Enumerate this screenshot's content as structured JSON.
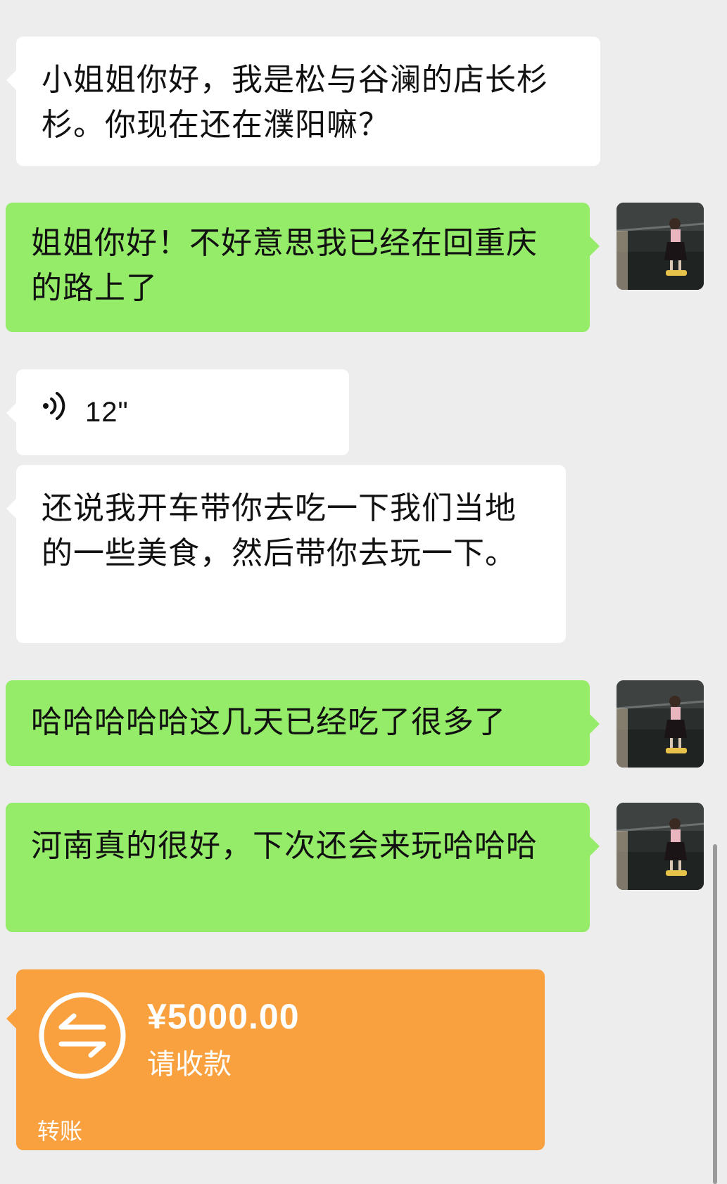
{
  "messages": [
    {
      "side": "in",
      "type": "text",
      "text": "小姐姐你好，我是松与谷澜的店长杉杉。你现在还在濮阳嘛？"
    },
    {
      "side": "out",
      "type": "text",
      "text": "姐姐你好！不好意思我已经在回重庆的路上了"
    },
    {
      "side": "in",
      "type": "voice",
      "duration": "12\""
    },
    {
      "side": "in",
      "type": "text",
      "text": "还说我开车带你去吃一下我们当地的一些美食，然后带你去玩一下。"
    },
    {
      "side": "out",
      "type": "text",
      "text": "哈哈哈哈哈这几天已经吃了很多了"
    },
    {
      "side": "out",
      "type": "text",
      "text": "河南真的很好，下次还会来玩哈哈哈"
    }
  ],
  "transfer": {
    "amount": "¥5000.00",
    "status": "请收款",
    "label": "转账",
    "icon": "transfer-arrows-icon"
  },
  "avatar": {
    "icon": "user-avatar-photo"
  },
  "colors": {
    "background": "#ededed",
    "incoming_bubble": "#ffffff",
    "outgoing_bubble": "#95ec69",
    "transfer_card": "#f9a03f"
  }
}
